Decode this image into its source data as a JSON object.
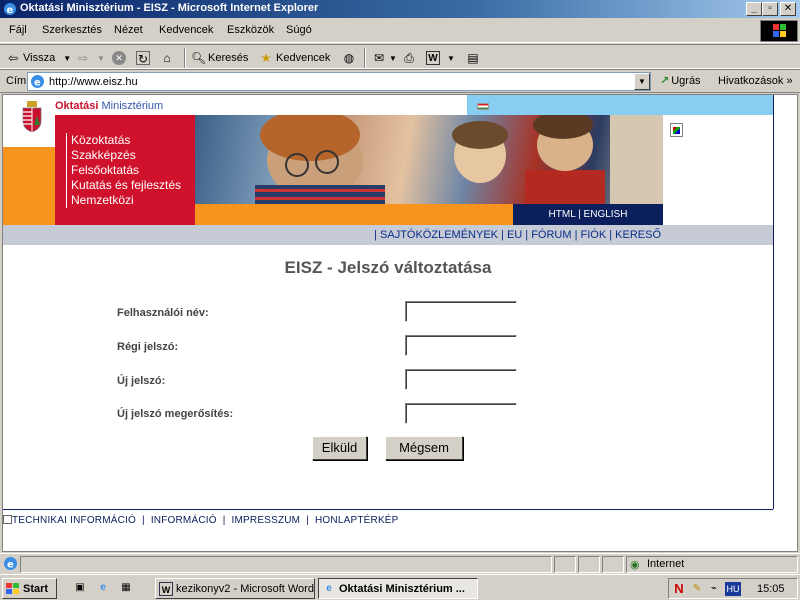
{
  "window": {
    "title": "Oktatási Minisztérium - EISZ - Microsoft Internet Explorer",
    "buttons": {
      "minimize": "_",
      "maximize": "▫",
      "close": "✕"
    }
  },
  "menu": [
    "Fájl",
    "Szerkesztés",
    "Nézet",
    "Kedvencek",
    "Eszközök",
    "Súgó"
  ],
  "toolbar": {
    "back": "Vissza",
    "search": "Keresés",
    "favorites": "Kedvencek"
  },
  "address": {
    "label": "Cím",
    "url": "http://www.eisz.hu",
    "go": "Ugrás",
    "links": "Hivatkozások"
  },
  "site": {
    "ministry_bold": "Oktatási",
    "ministry_rest": " Minisztérium",
    "nav": [
      "Közoktatás",
      "Szakképzés",
      "Felsőoktatás",
      "Kutatás és fejlesztés",
      "Nemzetközi"
    ],
    "lang": "HTML | ENGLISH",
    "topnav": "| SAJTÓKÖZLEMÉNYEK | EU | FÓRUM | FIÓK | KERESŐ"
  },
  "form": {
    "title": "EISZ - Jelszó változtatása",
    "fields": [
      {
        "label": "Felhasználói név:",
        "value": ""
      },
      {
        "label": "Régi jelszó:",
        "value": ""
      },
      {
        "label": "Új jelszó:",
        "value": ""
      },
      {
        "label": "Új jelszó megerősítés:",
        "value": ""
      }
    ],
    "submit": "Elküld",
    "cancel": "Mégsem"
  },
  "footer": {
    "items": [
      "TECHNIKAI INFORMÁCIÓ",
      "INFORMÁCIÓ",
      "IMPRESSZUM",
      "HONLAPTÉRKÉP"
    ]
  },
  "status": {
    "zone": "Internet"
  },
  "taskbar": {
    "start": "Start",
    "tasks": [
      "kezikonyv2 - Microsoft Word",
      "Oktatási Minisztérium ..."
    ],
    "tray_lang": "HU",
    "clock": "15:05"
  }
}
